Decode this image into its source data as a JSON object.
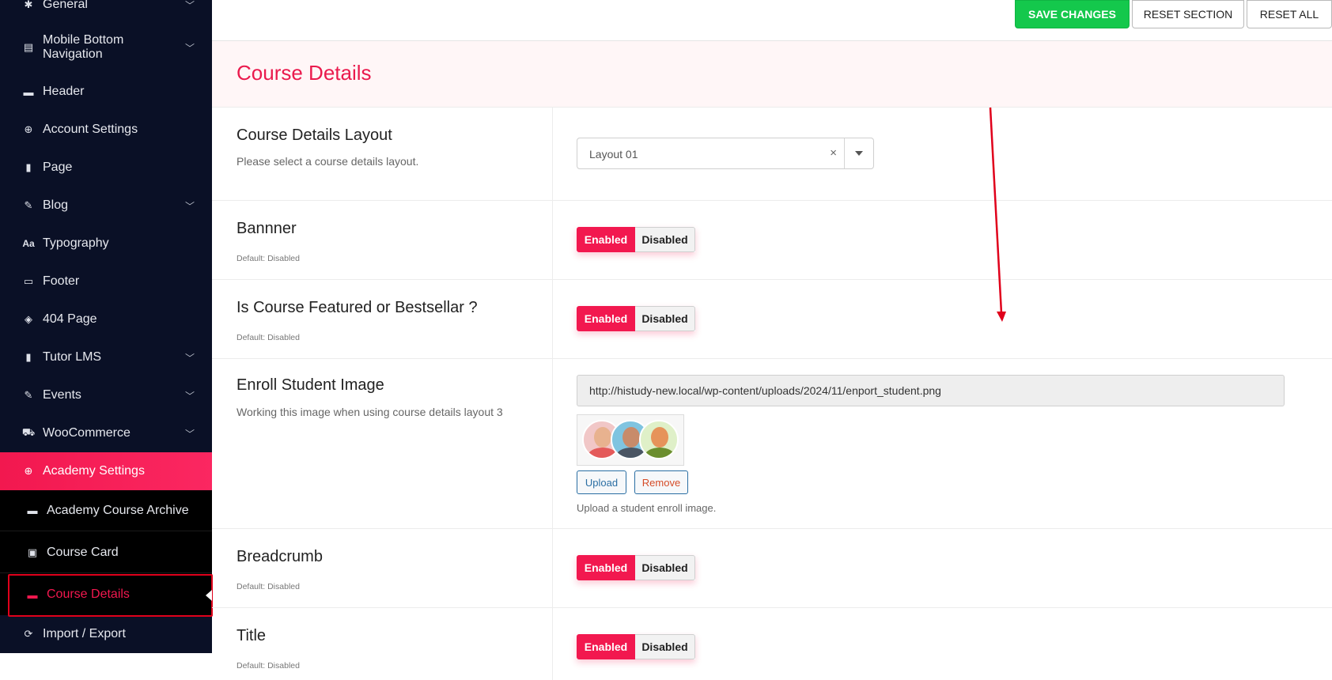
{
  "sidebar": {
    "items": [
      {
        "label": "General",
        "icon": "gear-icon",
        "chevron": true
      },
      {
        "label": "Mobile Bottom Navigation",
        "icon": "clipboard-icon",
        "chevron": true
      },
      {
        "label": "Header",
        "icon": "minus-icon",
        "chevron": false
      },
      {
        "label": "Account Settings",
        "icon": "search-circle-icon",
        "chevron": false
      },
      {
        "label": "Page",
        "icon": "file-icon",
        "chevron": false
      },
      {
        "label": "Blog",
        "icon": "edit-icon",
        "chevron": true
      },
      {
        "label": "Typography",
        "icon": "font-icon",
        "chevron": false
      },
      {
        "label": "Footer",
        "icon": "monitor-icon",
        "chevron": false
      },
      {
        "label": "404 Page",
        "icon": "eye-slash-icon",
        "chevron": false
      },
      {
        "label": "Tutor LMS",
        "icon": "file-icon",
        "chevron": true
      },
      {
        "label": "Events",
        "icon": "edit-icon",
        "chevron": true
      },
      {
        "label": "WooCommerce",
        "icon": "cart-icon",
        "chevron": true
      },
      {
        "label": "Academy Settings",
        "icon": "search-circle-icon",
        "chevron": false
      }
    ],
    "submenu": [
      {
        "label": "Academy Course Archive",
        "icon": "folder-icon"
      },
      {
        "label": "Course Card",
        "icon": "image-icon"
      },
      {
        "label": "Course Details",
        "icon": "folder-icon"
      }
    ],
    "footer_item": {
      "label": "Import / Export",
      "icon": "refresh-icon"
    },
    "icon_glyphs": {
      "gear-icon": "✱",
      "clipboard-icon": "▤",
      "minus-icon": "▬",
      "search-circle-icon": "⊕",
      "file-icon": "▮",
      "edit-icon": "✎",
      "font-icon": "Aa",
      "monitor-icon": "▭",
      "eye-slash-icon": "◈",
      "cart-icon": "⛟",
      "folder-icon": "▬",
      "image-icon": "▣",
      "refresh-icon": "⟳"
    }
  },
  "toolbar": {
    "save_label": "SAVE CHANGES",
    "reset_section_label": "RESET SECTION",
    "reset_all_label": "RESET ALL"
  },
  "section": {
    "title": "Course Details"
  },
  "fields": {
    "layout": {
      "title": "Course Details Layout",
      "description": "Please select a course details layout.",
      "selected": "Layout 01",
      "clear_glyph": "×"
    },
    "banner": {
      "title": "Bannner",
      "default": "Default: Disabled",
      "on": "Enabled",
      "off": "Disabled"
    },
    "featured": {
      "title": "Is Course Featured or Bestsellar ?",
      "default": "Default: Disabled",
      "on": "Enabled",
      "off": "Disabled"
    },
    "enroll_image": {
      "title": "Enroll Student Image",
      "description": "Working this image when using course details layout 3",
      "url": "http://histudy-new.local/wp-content/uploads/2024/11/enport_student.png",
      "upload_label": "Upload",
      "remove_label": "Remove",
      "hint": "Upload a student enroll image."
    },
    "breadcrumb": {
      "title": "Breadcrumb",
      "default": "Default: Disabled",
      "on": "Enabled",
      "off": "Disabled"
    },
    "title_toggle": {
      "title": "Title",
      "default": "Default: Disabled",
      "on": "Enabled",
      "off": "Disabled"
    }
  },
  "colors": {
    "accent": "#f2184f",
    "sidebar_bg": "#0a1026",
    "save_green": "#14c84c",
    "annotation_red": "#e0001b"
  }
}
